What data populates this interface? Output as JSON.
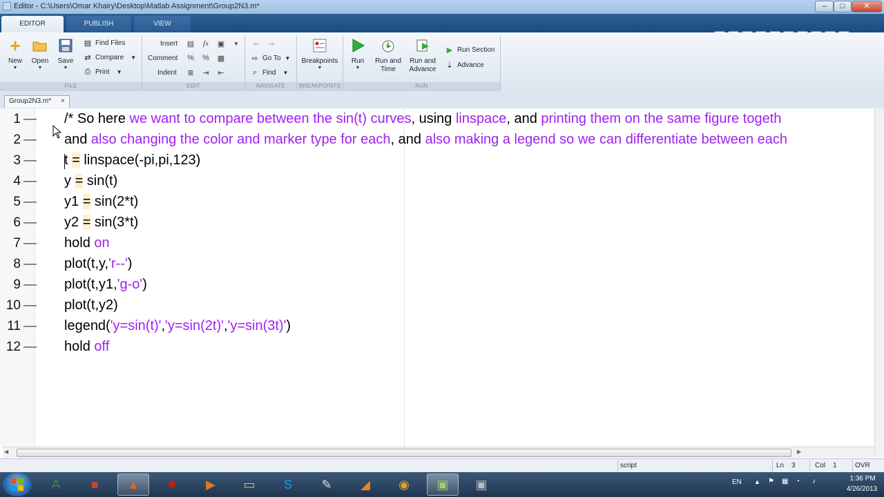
{
  "window": {
    "title": "Editor - C:\\Users\\Omar Khairy\\Desktop\\Matlab Assignment\\Group2N3.m*"
  },
  "tabs": [
    "EDITOR",
    "PUBLISH",
    "VIEW"
  ],
  "ribbon": {
    "file": {
      "group_label": "FILE",
      "new": "New",
      "open": "Open",
      "save": "Save",
      "find_files": "Find Files",
      "compare": "Compare",
      "print": "Print"
    },
    "edit": {
      "group_label": "EDIT",
      "insert": "Insert",
      "comment": "Comment",
      "indent": "Indent"
    },
    "navigate": {
      "group_label": "NAVIGATE",
      "go_to": "Go To",
      "find": "Find"
    },
    "breakpoints": {
      "group_label": "BREAKPOINTS",
      "breakpoints": "Breakpoints"
    },
    "run": {
      "group_label": "RUN",
      "run": "Run",
      "run_and_time": "Run and\nTime",
      "run_and_advance": "Run and\nAdvance",
      "run_section": "Run Section",
      "advance": "Advance"
    }
  },
  "document_tab": {
    "label": "Group2N3.m*",
    "close": "×"
  },
  "code_lines": [
    {
      "n": "1",
      "dash": "—",
      "parts": [
        {
          "t": "/* So here ",
          "c": ""
        },
        {
          "t": "we want to compare between the sin(t) curves",
          "c": "cm"
        },
        {
          "t": ", using ",
          "c": ""
        },
        {
          "t": "linspace",
          "c": "cm"
        },
        {
          "t": ", ",
          "c": ""
        },
        {
          "t": "and",
          "c": ""
        },
        {
          "t": " printing them on the same figure togeth",
          "c": "cm"
        }
      ]
    },
    {
      "n": "2",
      "dash": "—",
      "parts": [
        {
          "t": "and",
          "c": ""
        },
        {
          "t": " also changing the color and marker type for each",
          "c": "cm"
        },
        {
          "t": ", ",
          "c": ""
        },
        {
          "t": "and",
          "c": ""
        },
        {
          "t": " also making a legend so we can differentiate between each",
          "c": "cm"
        }
      ]
    },
    {
      "n": "3",
      "dash": "—",
      "parts": [
        {
          "t": "t ",
          "c": ""
        },
        {
          "t": "=",
          "c": "hl"
        },
        {
          "t": " linspace(-pi,pi,123)",
          "c": ""
        }
      ]
    },
    {
      "n": "4",
      "dash": "—",
      "parts": [
        {
          "t": "y ",
          "c": ""
        },
        {
          "t": "=",
          "c": "hl"
        },
        {
          "t": " sin(t)",
          "c": ""
        }
      ]
    },
    {
      "n": "5",
      "dash": "—",
      "parts": [
        {
          "t": "y1 ",
          "c": ""
        },
        {
          "t": "=",
          "c": "hl"
        },
        {
          "t": " sin(2*t)",
          "c": ""
        }
      ]
    },
    {
      "n": "6",
      "dash": "—",
      "parts": [
        {
          "t": "y2 ",
          "c": ""
        },
        {
          "t": "=",
          "c": "hl"
        },
        {
          "t": " sin(3*t)",
          "c": ""
        }
      ]
    },
    {
      "n": "7",
      "dash": "—",
      "parts": [
        {
          "t": "hold ",
          "c": ""
        },
        {
          "t": "on",
          "c": "kw"
        }
      ]
    },
    {
      "n": "8",
      "dash": "—",
      "parts": [
        {
          "t": "plot(t,y,",
          "c": ""
        },
        {
          "t": "'r--'",
          "c": "str"
        },
        {
          "t": ")",
          "c": ""
        }
      ]
    },
    {
      "n": "9",
      "dash": "—",
      "parts": [
        {
          "t": "plot(t,y1,",
          "c": ""
        },
        {
          "t": "'g-o'",
          "c": "str"
        },
        {
          "t": ")",
          "c": ""
        }
      ]
    },
    {
      "n": "10",
      "dash": "—",
      "parts": [
        {
          "t": "plot(t,y2)",
          "c": ""
        }
      ]
    },
    {
      "n": "11",
      "dash": "—",
      "parts": [
        {
          "t": "legend(",
          "c": ""
        },
        {
          "t": "'y=sin(t)'",
          "c": "str"
        },
        {
          "t": ",",
          "c": ""
        },
        {
          "t": "'y=sin(2t)'",
          "c": "str"
        },
        {
          "t": ",",
          "c": ""
        },
        {
          "t": "'y=sin(3t)'",
          "c": "str"
        },
        {
          "t": ")",
          "c": ""
        }
      ]
    },
    {
      "n": "12",
      "dash": "—",
      "parts": [
        {
          "t": "hold ",
          "c": ""
        },
        {
          "t": "off",
          "c": "kw"
        }
      ]
    }
  ],
  "status_bar": {
    "mode": "script",
    "ln_label": "Ln",
    "ln_value": "3",
    "col_label": "Col",
    "col_value": "1",
    "ovr": "OVR"
  },
  "taskbar": {
    "apps": [
      {
        "name": "vocabulary-app-icon",
        "glyph": "A"
      },
      {
        "name": "office-icon",
        "glyph": "■"
      },
      {
        "name": "matlab-icon",
        "glyph": "▲"
      },
      {
        "name": "burst-app-icon",
        "glyph": "✸"
      },
      {
        "name": "media-player-icon",
        "glyph": "▶"
      },
      {
        "name": "folder-icon",
        "glyph": "▭"
      },
      {
        "name": "skype-icon",
        "glyph": "S"
      },
      {
        "name": "tools-icon",
        "glyph": "✎"
      },
      {
        "name": "drawing-app-icon",
        "glyph": "◢"
      },
      {
        "name": "chrome-icon",
        "glyph": "◉"
      },
      {
        "name": "recorder-icon",
        "glyph": "▣"
      },
      {
        "name": "recorder-2-icon",
        "glyph": "▣"
      }
    ],
    "language": "EN",
    "time": "1:36 PM",
    "date": "4/26/2013"
  },
  "colors": {
    "keyword": "#a020f0",
    "titlebar": "#b7d3ee",
    "tabstrip": "#1d4a7e",
    "assign_highlight": "#fff0c8"
  }
}
